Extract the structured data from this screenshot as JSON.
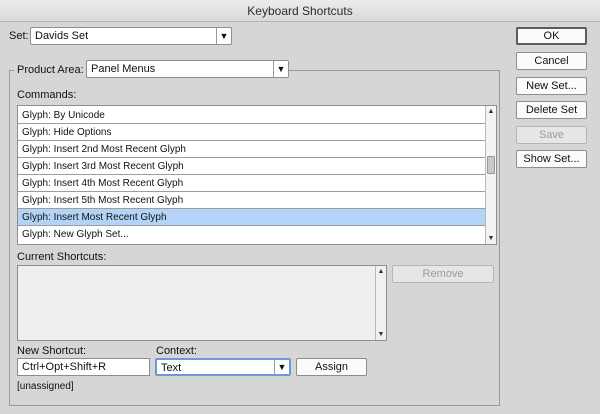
{
  "window": {
    "title": "Keyboard Shortcuts"
  },
  "set": {
    "label": "Set:",
    "value": "Davids Set"
  },
  "product_area": {
    "label": "Product Area:",
    "value": "Panel Menus"
  },
  "commands": {
    "label": "Commands:",
    "items": [
      "Glyph: By Unicode",
      "Glyph: Hide Options",
      "Glyph: Insert 2nd Most Recent Glyph",
      "Glyph: Insert 3rd Most Recent Glyph",
      "Glyph: Insert 4th Most Recent Glyph",
      "Glyph: Insert 5th Most Recent Glyph",
      "Glyph: Insert Most Recent Glyph",
      "Glyph: New Glyph Set..."
    ],
    "selected_item": "Glyph: Insert Most Recent Glyph"
  },
  "current_shortcuts": {
    "label": "Current Shortcuts:"
  },
  "new_shortcut": {
    "label": "New Shortcut:",
    "value": "Ctrl+Opt+Shift+R"
  },
  "context": {
    "label": "Context:",
    "value": "Text"
  },
  "status": "[unassigned]",
  "buttons": {
    "ok": "OK",
    "cancel": "Cancel",
    "new_set": "New Set...",
    "delete_set": "Delete Set",
    "save": "Save",
    "show_set": "Show Set...",
    "remove": "Remove",
    "assign": "Assign"
  },
  "icons": {
    "dropdown": "chevron-down-icon",
    "scroll_up": "arrow-up-icon",
    "scroll_down": "arrow-down-icon"
  },
  "colors": {
    "selection": "#b3d4f7",
    "background": "#d6d6d6"
  }
}
